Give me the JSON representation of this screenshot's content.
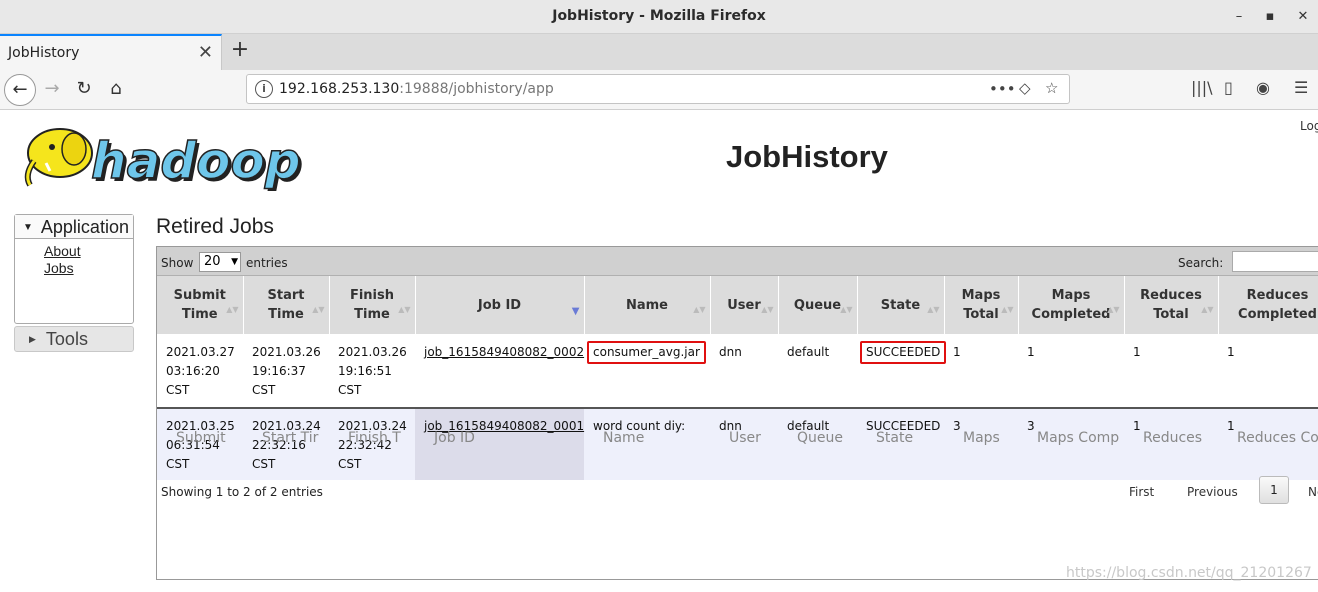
{
  "window": {
    "title": "JobHistory - Mozilla Firefox",
    "minimize": "–",
    "maximize": "▪",
    "close": "✕"
  },
  "tab": {
    "label": "JobHistory",
    "close": "✕",
    "new": "+"
  },
  "nav": {
    "back": "←",
    "forward": "→",
    "reload": "↻",
    "home": "⌂",
    "info": "i"
  },
  "url": {
    "host": "192.168.253.130",
    "rest": ":19888/jobhistory/app",
    "more": "•••",
    "pocket": "◇",
    "star": "☆"
  },
  "toolbar_icons": {
    "library": "|||\\",
    "sidebar": "▯",
    "account": "◉",
    "menu": "☰"
  },
  "page": {
    "title": "JobHistory",
    "logged_in": "Log",
    "logo_text": "hadoop"
  },
  "sidebar": {
    "application": "Application",
    "links": [
      "About",
      "Jobs"
    ],
    "tools": "Tools"
  },
  "section": {
    "title": "Retired Jobs"
  },
  "table": {
    "show": "Show",
    "page_size": "20",
    "entries": "entries",
    "search": "Search:",
    "headers": [
      "Submit\nTime",
      "Start\nTime",
      "Finish\nTime",
      "Job ID",
      "Name",
      "User",
      "Queue",
      "State",
      "Maps\nTotal",
      "Maps\nCompleted",
      "Reduces\nTotal",
      "Reduces\nCompleted"
    ],
    "rows": [
      {
        "submit": "2021.03.27\n03:16:20\nCST",
        "start": "2021.03.26\n19:16:37\nCST",
        "finish": "2021.03.26\n19:16:51\nCST",
        "job_id": "job_1615849408082_0002",
        "name": "consumer_avg.jar",
        "user": "dnn",
        "queue": "default",
        "state": "SUCCEEDED",
        "maps_total": "1",
        "maps_completed": "1",
        "reduces_total": "1",
        "reduces_completed": "1"
      },
      {
        "submit": "2021.03.25\n06:31:54\nCST",
        "start": "2021.03.24\n22:32:16\nCST",
        "finish": "2021.03.24\n22:32:42\nCST",
        "job_id": "job_1615849408082_0001",
        "name": "word count diy:",
        "user": "dnn",
        "queue": "default",
        "state": "SUCCEEDED",
        "maps_total": "3",
        "maps_completed": "3",
        "reduces_total": "1",
        "reduces_completed": "1"
      }
    ],
    "footer_filters": [
      "Submit ",
      "Start Tir",
      "Finish T",
      "Job ID",
      "Name",
      "User",
      "Queue",
      "State",
      "Maps",
      "Maps Comp",
      "Reduces",
      "Reduces Co"
    ],
    "info": "Showing 1 to 2 of 2 entries",
    "pager": {
      "first": "First",
      "previous": "Previous",
      "current": "1",
      "next": "Ne"
    }
  },
  "watermark": "https://blog.csdn.net/qq_21201267"
}
